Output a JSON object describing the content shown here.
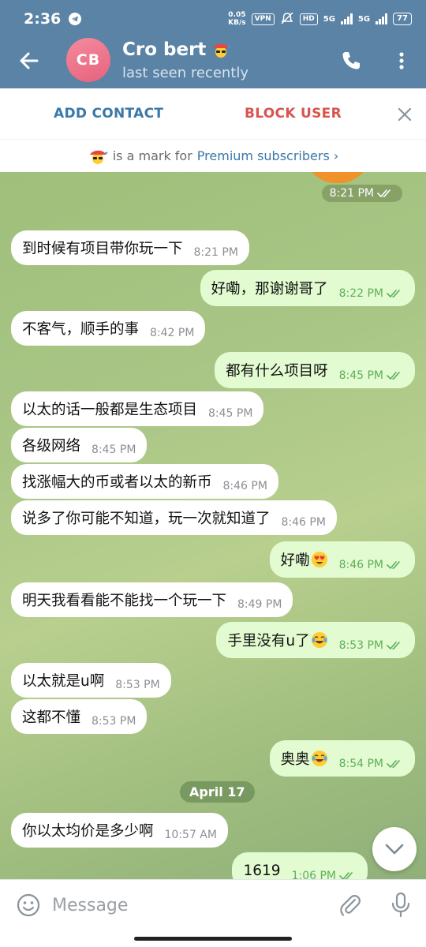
{
  "status_bar": {
    "time": "2:36",
    "net_speed_value": "0.05",
    "net_speed_unit": "KB/s",
    "vpn": "VPN",
    "hd": "HD",
    "signal1": "5G",
    "signal2": "5G",
    "battery": "77"
  },
  "header": {
    "avatar_initials": "CB",
    "contact_name": "Cro bert",
    "status": "last seen recently"
  },
  "action_bar": {
    "add_contact": "ADD CONTACT",
    "block_user": "BLOCK USER"
  },
  "premium_note": {
    "text": "is a mark for",
    "link": "Premium subscribers",
    "chevron": "›"
  },
  "chat": {
    "top_time": "8:21 PM",
    "date_divider": "April 17",
    "messages": [
      {
        "dir": "in",
        "text": "到时候有项目带你玩一下",
        "time": "8:21 PM"
      },
      {
        "dir": "out",
        "text": "好嘞，那谢谢哥了",
        "time": "8:22 PM"
      },
      {
        "dir": "in",
        "text": "不客气，顺手的事",
        "time": "8:42 PM"
      },
      {
        "dir": "out",
        "text": "都有什么项目呀",
        "time": "8:45 PM"
      },
      {
        "dir": "in",
        "text": "以太的话一般都是生态项目",
        "time": "8:45 PM"
      },
      {
        "dir": "in",
        "text": "各级网络",
        "time": "8:45 PM"
      },
      {
        "dir": "in",
        "text": "找涨幅大的币或者以太的新币",
        "time": "8:46 PM"
      },
      {
        "dir": "in",
        "text": "说多了你可能不知道，玩一次就知道了",
        "time": "8:46 PM"
      },
      {
        "dir": "out",
        "text": "好嘞",
        "emoji": "heart-eyes",
        "time": "8:46 PM"
      },
      {
        "dir": "in",
        "text": "明天我看看能不能找一个玩一下",
        "time": "8:49 PM"
      },
      {
        "dir": "out",
        "text": "手里没有u了",
        "emoji": "tears-of-joy",
        "time": "8:53 PM"
      },
      {
        "dir": "in",
        "text": "以太就是u啊",
        "time": "8:53 PM"
      },
      {
        "dir": "in",
        "text": "这都不懂",
        "time": "8:53 PM"
      },
      {
        "dir": "out",
        "text": "奥奥",
        "emoji": "tears-of-joy",
        "time": "8:54 PM"
      },
      {
        "dir": "in",
        "text": "你以太均价是多少啊",
        "time": "10:57 AM"
      },
      {
        "dir": "out",
        "text": "1619",
        "time": "1:06 PM"
      }
    ]
  },
  "input": {
    "placeholder": "Message"
  },
  "colors": {
    "header_bg": "#5a83a6",
    "accent_blue": "#3a78a8",
    "danger_red": "#d9534f",
    "outgoing_bubble": "#e3fbd0",
    "incoming_bubble": "#ffffff",
    "tick_green": "#5fae5c"
  }
}
